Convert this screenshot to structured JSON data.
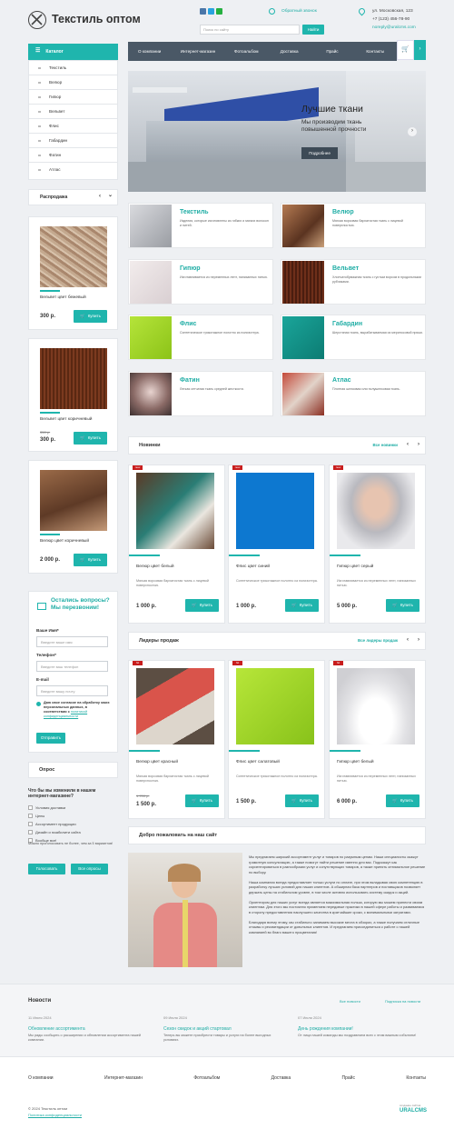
{
  "header": {
    "logo_text": "Текстиль оптом",
    "search_placeholder": "Поиск по сайту",
    "search_button": "Найти",
    "callback_label": "Обратный звонок",
    "address": "ул. Московская, 123",
    "phone": "+7 (123) 456-78-90",
    "email": "noreply@uralcms.com"
  },
  "sidebar": {
    "catalog_title": "Каталог",
    "items": [
      "Текстиль",
      "Велюр",
      "Гипюр",
      "Вельвет",
      "Флис",
      "Габардин",
      "Фатин",
      "Атлас"
    ],
    "sale_title": "Распродажа",
    "sale_cards": [
      {
        "badge": "sale",
        "name": "Вельвет цвет бежевый",
        "old_price": "",
        "price": "300 р.",
        "button": "Купить"
      },
      {
        "badge": "sale",
        "name": "Вельвет цвет коричневый",
        "old_price": "350 р.",
        "price": "300 р.",
        "button": "Купить"
      },
      {
        "badge": "sale",
        "name": "Велюр цвет коричневый",
        "old_price": "",
        "price": "2 000 р.",
        "button": "Купить"
      }
    ]
  },
  "form": {
    "title": "Остались вопросы? Мы перезвоним!",
    "name_label": "Ваше Имя*",
    "name_placeholder": "Введите ваше имя",
    "phone_label": "Телефон*",
    "phone_placeholder": "Введите ваш телефон",
    "email_label": "E-mail",
    "email_placeholder": "Введите вашу почту",
    "consent_text": "Даю свое согласие на обработку моих персональных данных, в соответствии с",
    "consent_link": "политикой конфиденциальности",
    "submit": "Отправить"
  },
  "poll": {
    "title": "Опрос",
    "question": "Что бы вы изменили в нашем интернет-магазине?",
    "options": [
      "Условия доставки",
      "Цены",
      "Ассортимент продукции",
      "Дизайн и юзабилити сайта",
      "Вообще все!"
    ],
    "note": "Можно проголосовать не более, чем за 5 вариантов!",
    "vote_button": "Голосовать",
    "all_polls_button": "Все опросы"
  },
  "nav": {
    "items": [
      "О компании",
      "Интернет-магазин",
      "Фотоальбом",
      "Доставка",
      "Прайс",
      "Контакты"
    ]
  },
  "hero": {
    "title": "Лучшие ткани",
    "subtitle": "Мы производим ткань повышенной прочности",
    "button": "Подробнее"
  },
  "categories": [
    {
      "name": "Текстиль",
      "desc": "Изделия, которые изготовлены из гибких и мягких волокон и нитей."
    },
    {
      "name": "Велюр",
      "desc": "Мягкая ворсовая бархатистая ткань с лицевой поверхностью."
    },
    {
      "name": "Гипюр",
      "desc": "Изготавливается из переменных лент, нанизанных нитью."
    },
    {
      "name": "Вельвет",
      "desc": "Хлопчатобумажная ткань с густым ворсом в продольными рубчиками."
    },
    {
      "name": "Флис",
      "desc": "Синтетическое трикотажное полотно из полиэстера."
    },
    {
      "name": "Габардин",
      "desc": "Шерстяная ткань, вырабатываемая из мериносовой пряжи."
    },
    {
      "name": "Фатин",
      "desc": "Легкая сетчатая ткань средней жесткости."
    },
    {
      "name": "Атлас",
      "desc": "Плотная шелковая или полушелковая ткань."
    }
  ],
  "new_section": {
    "title": "Новинки",
    "all_link": "Все новинки",
    "cards": [
      {
        "badge": "new",
        "name": "Велюр цвет белый",
        "desc": "Мягкая ворсовая бархатистая ткань с лицевой поверхностью.",
        "old_price": "",
        "price": "1 000 р.",
        "button": "Купить"
      },
      {
        "badge": "new",
        "name": "Флис цвет синий",
        "desc": "Синтетическое трикотажное полотно из полиэстера.",
        "old_price": "",
        "price": "1 000 р.",
        "button": "Купить"
      },
      {
        "badge": "new",
        "name": "Гипюр цвет серый",
        "desc": "Изготавливается из переменных лент, нанизанных нитью.",
        "old_price": "",
        "price": "5 000 р.",
        "button": "Купить"
      }
    ]
  },
  "hits_section": {
    "title": "Лидеры продаж",
    "all_link": "Все лидеры продаж",
    "cards": [
      {
        "badge": "hit",
        "name": "Велюр цвет красный",
        "desc": "Мягкая ворсовая бархатистая ткань с лицевой поверхностью.",
        "old_price": "1 700 р.",
        "price": "1 500 р.",
        "button": "Купить"
      },
      {
        "badge": "hit",
        "name": "Флис цвет салатовый",
        "desc": "Синтетическое трикотажное полотно из полиэстера.",
        "old_price": "",
        "price": "1 500 р.",
        "button": "Купить"
      },
      {
        "badge": "hit",
        "name": "Гипюр цвет белый",
        "desc": "Изготавливается из переменных лент, нанизанных нитью.",
        "old_price": "",
        "price": "6 000 р.",
        "button": "Купить"
      }
    ]
  },
  "welcome": {
    "title": "Добро пожаловать на наш сайт",
    "paragraphs": [
      "Мы предлагаем широкий ассортимент услуг и товаров по разумным ценам. Наши специалисты окажут грамотную консультацию, а также помогут найти решение именно для вас. Подскажут как сориентироваться в разнообразии услуг и сопутствующих товаров, а также принять оптимальное решение по выбору.",
      "Наша компания всегда предоставляет только услуги по оплате, при этом вкладывая свою компетенцию в разработку лучших условий для наших клиентов. А обширная база партнеров и поставщиков позволяет держать цены на стабильном уровне, в том числе активно использовать систему скидок и акций.",
      "Ориентиром для наших услуг всегда является максимальная польза, которую мы можем принести своим клиентам. Для этого мы постоянно применяем передовые практики в нашей сфере работы и развиваемся в сторону предоставления наилучшего качества в кратчайшие сроки, с минимальными затратами.",
      "Благодаря всему этому, мы стабильно занимаем высокие места в обзорах, а также получаем отличные отзывы и рекомендации от довольных клиентов. И предлагаем присоединиться к работе с нашей компанией во благо вашего процветания!"
    ]
  },
  "news": {
    "title": "Новости",
    "all_link": "Все новости",
    "subscribe_link": "Подписка на новости",
    "items": [
      {
        "date": "11 Июля 2024",
        "title": "Обновление ассортимента",
        "text": "Мы рады сообщить о расширении и обновлении ассортимента нашей компании."
      },
      {
        "date": "09 Июля 2024",
        "title": "Сезон скидок и акций стартовал",
        "text": "Теперь вы можете приобрести товары и услуги на более выгодных условиях."
      },
      {
        "date": "07 Июля 2024",
        "title": "День рождения компании!",
        "text": "От лица нашей команды мы поздравляем всех с этим важным событием!"
      }
    ]
  },
  "footer": {
    "nav": [
      "О компании",
      "Интернет-магазин",
      "Фотоальбом",
      "Доставка",
      "Прайс",
      "Контакты"
    ],
    "copyright": "© 2024 Текстиль оптом",
    "privacy_link": "Политика конфиденциальности",
    "cms_small": "создание сайтов",
    "cms": "URALCMS"
  },
  "colors": {
    "accent": "#1fb5ad",
    "menu": "#4a5866",
    "sale_badge": "#c81d1d",
    "background": "#eef0f3"
  }
}
